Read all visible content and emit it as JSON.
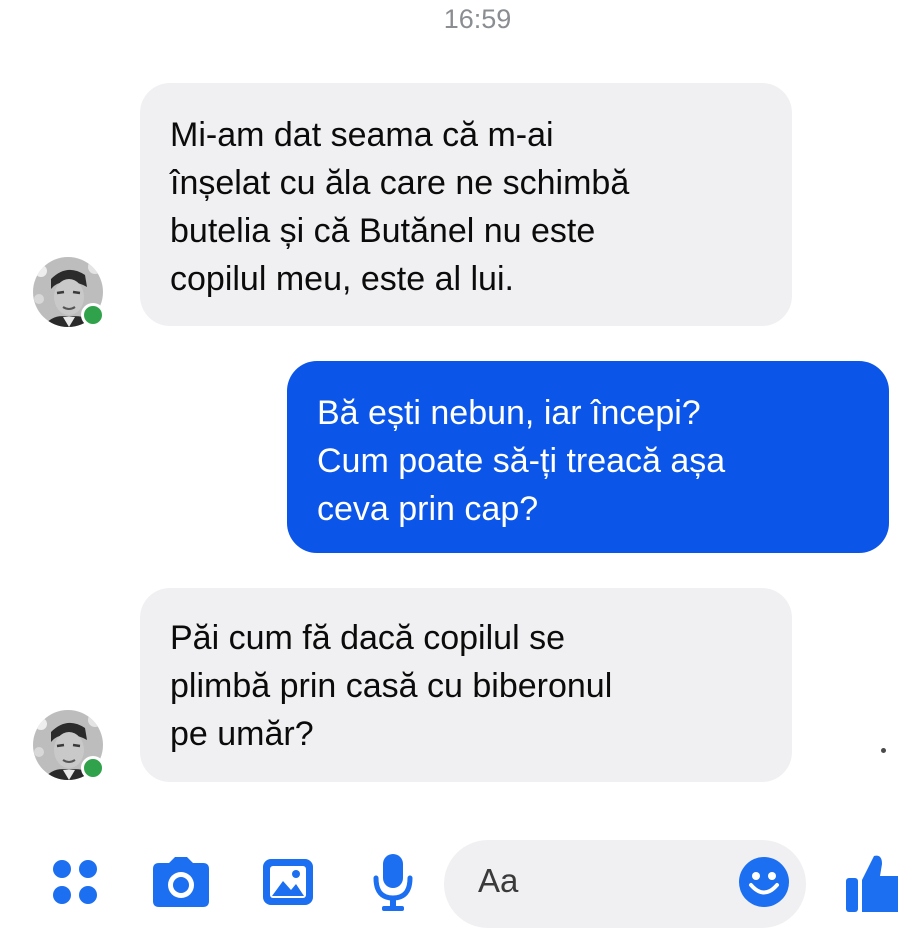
{
  "conversation": {
    "timestamp": "16:59",
    "messages": [
      {
        "direction": "incoming",
        "lines": [
          "Mi-am dat seama că m-ai",
          "înșelat cu ăla care ne schimbă",
          "butelia și că Butănel nu este",
          "copilul meu, este al lui."
        ]
      },
      {
        "direction": "outgoing",
        "lines": [
          "Bă ești nebun, iar începi?",
          "Cum poate să-ți treacă așa",
          "ceva prin cap?"
        ]
      },
      {
        "direction": "incoming",
        "lines": [
          "Păi cum fă dacă copilul se",
          "plimbă prin casă cu biberonul",
          "pe umăr?"
        ]
      }
    ]
  },
  "composer": {
    "placeholder": "Aa",
    "icons": [
      "more-icon",
      "camera-icon",
      "gallery-icon",
      "microphone-icon",
      "emoji-icon",
      "thumbs-up-icon"
    ]
  },
  "colors": {
    "accent": "#0b55e8",
    "icon_blue": "#1b6ff0",
    "incoming_bubble": "#f0f0f2",
    "presence_green": "#31a24c",
    "timestamp_gray": "#8a8d91"
  }
}
